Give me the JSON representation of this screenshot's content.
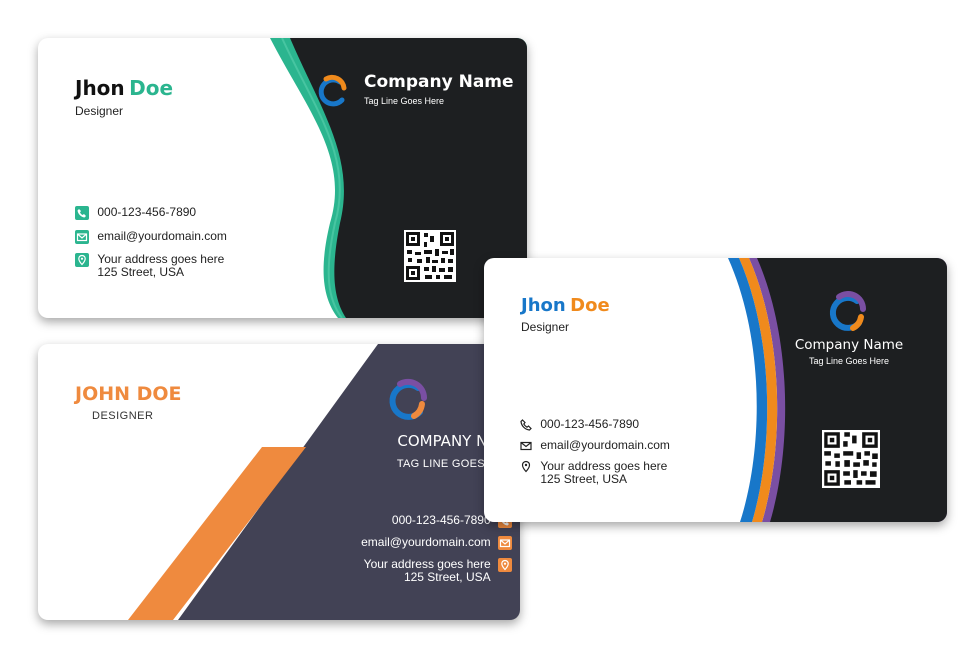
{
  "card1": {
    "first_name": "Jhon",
    "last_name": "Doe",
    "role": "Designer",
    "phone": "000-123-456-7890",
    "email": "email@yourdomain.com",
    "address_line1": "Your address goes here",
    "address_line2": "125 Street, USA",
    "company": "Company Name",
    "tagline": "Tag Line Goes Here",
    "colors": {
      "accent": "#2bb58f",
      "dark": "#1d1f21",
      "logo_blue": "#1877c9",
      "logo_orange": "#f08a1c"
    },
    "icons": [
      "phone-icon",
      "mail-icon",
      "location-icon",
      "qr-code"
    ]
  },
  "card2": {
    "name": "JOHN DOE",
    "role": "DESIGNER",
    "company": "COMPANY NAME",
    "tagline": "TAG LINE GOES HERE",
    "phone": "000-123-456-7890",
    "email": "email@yourdomain.com",
    "address_line1": "Your address goes here",
    "address_line2": "125 Street, USA",
    "colors": {
      "accent": "#ef8a3e",
      "dark": "#424255",
      "logo_blue": "#1877c9",
      "logo_purple": "#7a4fa3"
    },
    "icons": [
      "phone-icon",
      "mail-icon",
      "location-icon"
    ]
  },
  "card3": {
    "first_name": "Jhon",
    "last_name": "Doe",
    "role": "Designer",
    "phone": "000-123-456-7890",
    "email": "email@yourdomain.com",
    "address_line1": "Your address goes here",
    "address_line2": "125 Street, USA",
    "company": "Company Name",
    "tagline": "Tag Line Goes Here",
    "colors": {
      "blue": "#1877c9",
      "orange": "#f08a1c",
      "purple": "#7a4fa3",
      "dark": "#1d1f21"
    },
    "icons": [
      "phone-icon",
      "mail-icon",
      "location-icon",
      "qr-code"
    ]
  }
}
